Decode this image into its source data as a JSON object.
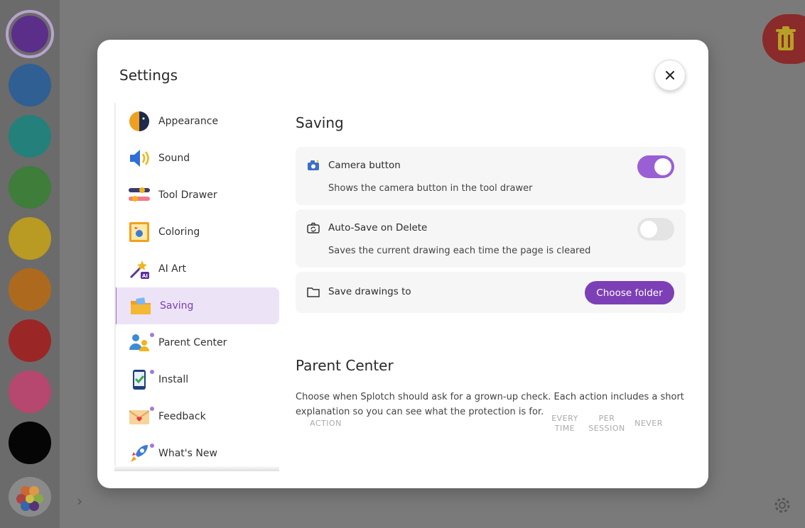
{
  "swatches": [
    "#5b2e8a",
    "#2f5f93",
    "#24807a",
    "#3f7d3a",
    "#b99a22",
    "#ad6a1e",
    "#9b2626",
    "#b6476f",
    "#050505"
  ],
  "modal": {
    "title": "Settings"
  },
  "nav": [
    {
      "label": "Appearance",
      "icon": "appearance-icon"
    },
    {
      "label": "Sound",
      "icon": "speaker-icon"
    },
    {
      "label": "Tool Drawer",
      "icon": "tool-drawer-icon"
    },
    {
      "label": "Coloring",
      "icon": "coloring-icon"
    },
    {
      "label": "AI Art",
      "icon": "ai-art-icon"
    },
    {
      "label": "Saving",
      "icon": "folder-icon",
      "active": true
    },
    {
      "label": "Parent Center",
      "icon": "parents-icon"
    },
    {
      "label": "Install",
      "icon": "phone-check-icon"
    },
    {
      "label": "Feedback",
      "icon": "envelope-icon"
    },
    {
      "label": "What's New",
      "icon": "rocket-icon"
    }
  ],
  "saving": {
    "title": "Saving",
    "camera": {
      "label": "Camera button",
      "desc": "Shows the camera button in the tool drawer",
      "on": true
    },
    "autosave": {
      "label": "Auto-Save on Delete",
      "desc": "Saves the current drawing each time the page is cleared",
      "on": false
    },
    "folder": {
      "label": "Save drawings to",
      "button": "Choose folder"
    }
  },
  "parent": {
    "title": "Parent Center",
    "text": "Choose when Splotch should ask for a grown-up check. Each action includes a short explanation so you can see what the protection is for.",
    "cols": {
      "action": "ACTION",
      "every": "EVERY TIME",
      "session": "PER SESSION",
      "never": "NEVER"
    }
  },
  "colors": {
    "accent": "#7c3fb6",
    "toggle_on": "#9a5fd4"
  }
}
